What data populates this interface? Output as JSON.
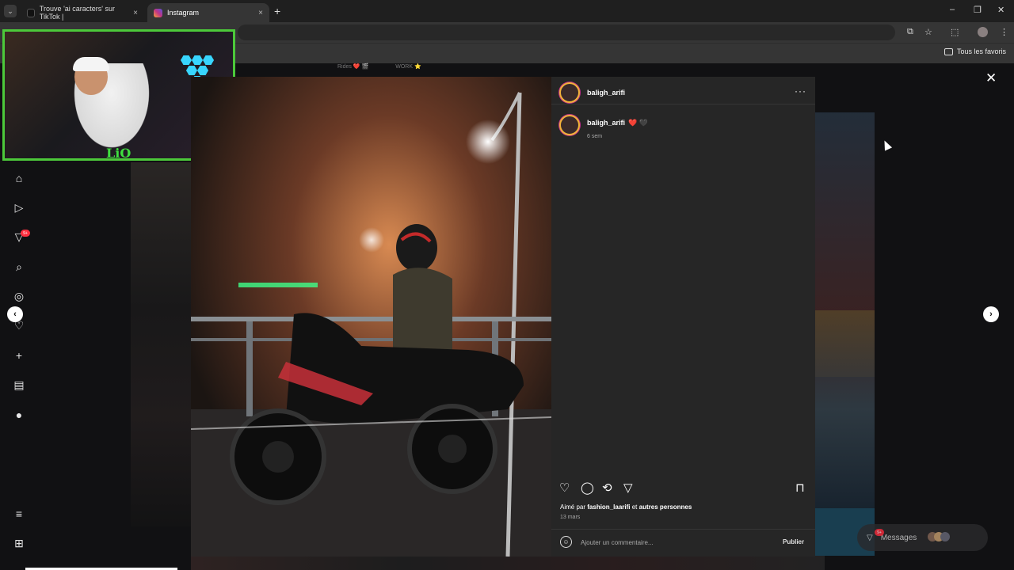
{
  "browser": {
    "tabs": [
      {
        "label": "Trouve 'ai caracters' sur TikTok |",
        "active": false
      },
      {
        "label": "Instagram",
        "active": true
      }
    ],
    "new_tab": "+",
    "close": "×",
    "window_controls": [
      "–",
      "❐",
      "✕"
    ],
    "bookmarks_folder": "Tous les favoris"
  },
  "profile_tabs": [
    "Rides ❤️ 🎬",
    "WORK ⭐"
  ],
  "sidebar": {
    "icons": [
      "home-icon",
      "reels-icon",
      "messages-icon",
      "search-icon",
      "explore-icon",
      "notifications-icon",
      "create-icon",
      "dashboard-icon",
      "profile-icon",
      "menu-icon",
      "more-icon"
    ],
    "notif_badge": "9+"
  },
  "webcam": {
    "logo": "LiO"
  },
  "post": {
    "username": "baligh_arifi",
    "more": "···",
    "caption_user": "baligh_arifi",
    "caption_emoji": "❤️ 🖤",
    "caption_time": "6 sem",
    "likes_prefix": "Aimé par",
    "likes_user": "fashion_laarifi",
    "likes_mid": "et",
    "likes_suffix": "autres personnes",
    "date": "13 mars",
    "comment_placeholder": "Ajouter un commentaire...",
    "publish": "Publier"
  },
  "messages": {
    "label": "Messages",
    "badge": "9+"
  },
  "colors": {
    "accent": "#4cc93a",
    "panel": "#262626",
    "badge": "#ff3040"
  }
}
